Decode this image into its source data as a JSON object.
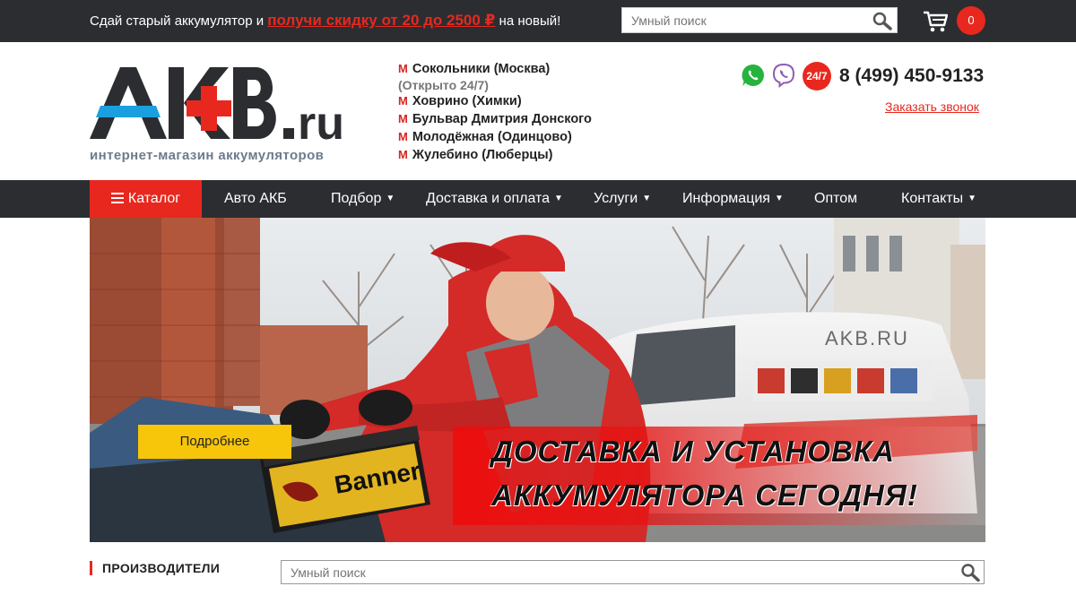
{
  "topbar": {
    "promo_prefix": "Сдай старый аккумулятор и ",
    "promo_highlight": "получи скидку от 20 до 2500 ₽",
    "promo_suffix": " на новый!",
    "search_placeholder": "Умный поиск",
    "search_icon": "search-icon",
    "cart_icon": "cart-icon",
    "cart_count": "0"
  },
  "header": {
    "logo_text": "AKB.ru",
    "logo_subtitle": "интернет-магазин аккумуляторов",
    "locations": [
      {
        "name": "Сокольники (Москва)",
        "note": "(Открыто 24/7)"
      },
      {
        "name": "Ховрино (Химки)"
      },
      {
        "name": "Бульвар Дмитрия Донского"
      },
      {
        "name": "Молодёжная (Одинцово)"
      },
      {
        "name": "Жулебино (Люберцы)"
      }
    ],
    "metro_symbol": "М",
    "badge_247": "24/7",
    "phone": "8 (499) 450-9133",
    "callback_label": "Заказать звонок",
    "icons": [
      "whatsapp-icon",
      "viber-icon"
    ]
  },
  "nav": {
    "catalog": "Каталог",
    "items": [
      "Авто АКБ",
      "Подбор",
      "Доставка и оплата",
      "Услуги",
      "Информация",
      "Оптом",
      "Контакты"
    ],
    "caret": "▼"
  },
  "banner": {
    "button_label": "Подробнее",
    "line1": "ДОСТАВКА И УСТАНОВКА",
    "line2": "АККУМУЛЯТОРА СЕГОДНЯ!",
    "van_text": "AKB.RU",
    "battery_brand": "Banner"
  },
  "bottom": {
    "section_title": "ПРОИЗВОДИТЕЛИ",
    "search_placeholder": "Умный поиск"
  },
  "colors": {
    "accent": "#e8281e",
    "dark": "#2c2d31",
    "button_yellow": "#f7c50a",
    "logo_blue": "#1aa0e0"
  }
}
